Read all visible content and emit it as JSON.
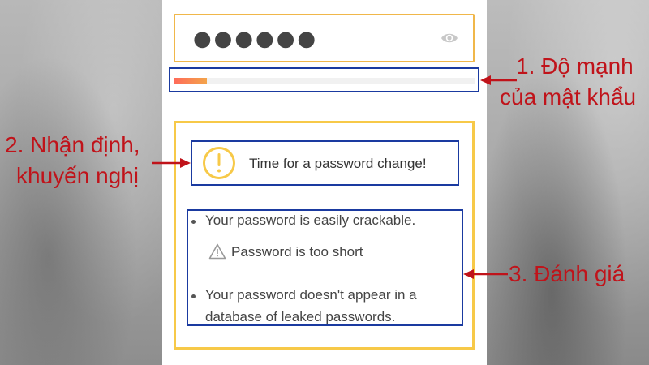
{
  "password_field": {
    "masked_value": "●●●●●●",
    "visibility_icon": "eye-icon",
    "border_color": "#f0b74a"
  },
  "strength_meter": {
    "fill_fraction": 0.11,
    "fill_colors": [
      "#ff6a5a",
      "#f3a44a"
    ]
  },
  "assessment": {
    "verdict_icon": "warning-circle-icon",
    "verdict": "Time for a password change!",
    "details": [
      {
        "text": "Your password is easily crackable."
      },
      {
        "text": "Password is too short",
        "icon": "warning-triangle-icon"
      },
      {
        "lines": [
          "Your password doesn't appear in a",
          "database of leaked passwords."
        ]
      }
    ],
    "border_color": "#f7c948"
  },
  "annotations": {
    "color": "#c0131a",
    "box_color": "#1a3aa0",
    "strength": [
      "1. Độ mạnh",
      "của mật khẩu"
    ],
    "verdict": [
      "2. Nhận định,",
      "khuyến nghị"
    ],
    "evaluation": "3. Đánh giá"
  }
}
